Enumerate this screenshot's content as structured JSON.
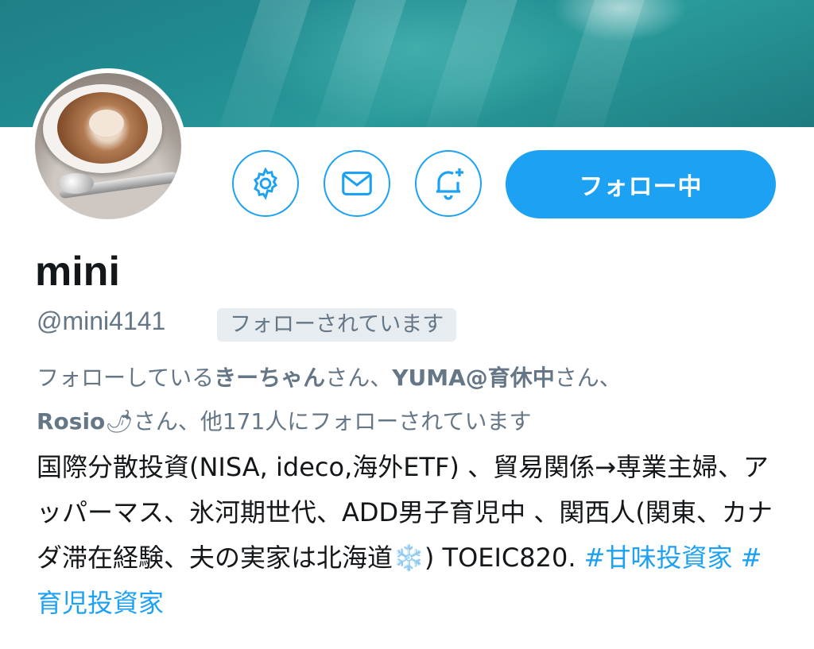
{
  "profile": {
    "name": "mini",
    "handle": "@mini4141",
    "follows_you_badge": "フォローされています",
    "follow_button_label": "フォロー中"
  },
  "followed_by": {
    "prefix": "フォローしている",
    "user1": "きーちゃん",
    "suffix1": "さん、",
    "user2": "YUMA@育休中",
    "suffix2": "さん、",
    "user3": "Rosio",
    "emoji3": "🌶",
    "suffix3": "さん、他171人にフォローされています"
  },
  "bio": {
    "text": "国際分散投資(NISA, ideco,海外ETF) 、貿易関係→専業主婦、アッパーマス、氷河期世代、ADD男子育児中 、関西人(関東、カナダ滞在経験、夫の実家は北海道",
    "emoji": "❄️",
    "text2": ") TOEIC820. ",
    "hashtag1": "#甘味投資家",
    "hashtag2": "#育児投資家"
  },
  "icons": {
    "settings": "gear-icon",
    "message": "envelope-icon",
    "notifications": "bell-plus-icon"
  },
  "colors": {
    "accent": "#1da1f2",
    "secondary_text": "#657786",
    "primary_text": "#14171a"
  }
}
